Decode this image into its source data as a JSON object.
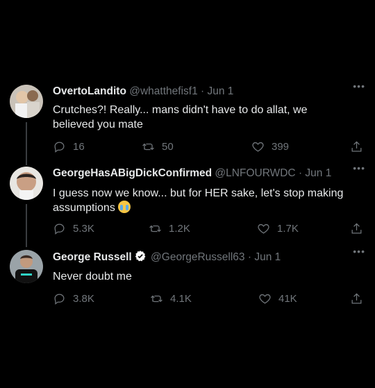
{
  "tweets": [
    {
      "display_name": "OvertoLandito",
      "handle": "@whatthefisf1",
      "sep": "·",
      "date": "Jun 1",
      "text": "Crutches?! Really... mans didn't have to do allat, we believed you mate",
      "replies": "16",
      "retweets": "50",
      "likes": "399"
    },
    {
      "display_name": "GeorgeHasABigDickConfirmed",
      "handle": "@LNFOURWDC",
      "sep": "·",
      "date": "Jun 1",
      "text": "I guess now we know... but for HER sake, let's stop making assumptions",
      "emoji": "crying-face-emoji",
      "replies": "5.3K",
      "retweets": "1.2K",
      "likes": "1.7K"
    },
    {
      "display_name": "George Russell",
      "verified": true,
      "handle": "@GeorgeRussell63",
      "sep": "·",
      "date": "Jun 1",
      "text": "Never doubt me",
      "replies": "3.8K",
      "retweets": "4.1K",
      "likes": "41K"
    }
  ],
  "more_label": "•••",
  "colors": {
    "background": "#000000",
    "text": "#e7e9ea",
    "muted": "#71767b",
    "verified": "#ffffff"
  }
}
